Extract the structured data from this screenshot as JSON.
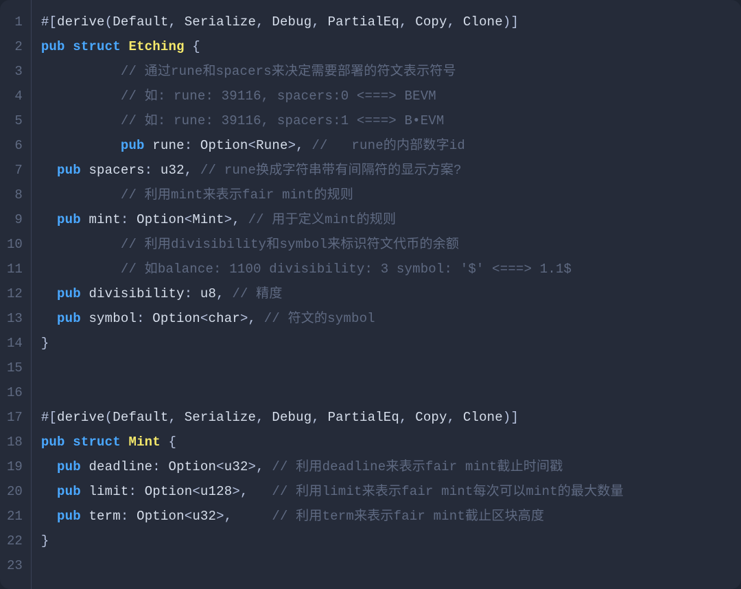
{
  "language": "rust",
  "theme": {
    "background": "#252b39",
    "gutter_border": "#3a4256",
    "line_number": "#5f6a82",
    "default_text": "#d6deeb",
    "keyword": "#4aa8ff",
    "struct_name": "#f5e96b",
    "comment": "#5f6a82"
  },
  "lines": [
    {
      "n": 1,
      "tokens": [
        {
          "c": "tok-punct",
          "t": "#["
        },
        {
          "c": "tok-attr",
          "t": "derive"
        },
        {
          "c": "tok-punct",
          "t": "("
        },
        {
          "c": "tok-attr",
          "t": "Default"
        },
        {
          "c": "tok-punct",
          "t": ", "
        },
        {
          "c": "tok-attr",
          "t": "Serialize"
        },
        {
          "c": "tok-punct",
          "t": ", "
        },
        {
          "c": "tok-attr",
          "t": "Debug"
        },
        {
          "c": "tok-punct",
          "t": ", "
        },
        {
          "c": "tok-attr",
          "t": "PartialEq"
        },
        {
          "c": "tok-punct",
          "t": ", "
        },
        {
          "c": "tok-attr",
          "t": "Copy"
        },
        {
          "c": "tok-punct",
          "t": ", "
        },
        {
          "c": "tok-attr",
          "t": "Clone"
        },
        {
          "c": "tok-punct",
          "t": ")]"
        }
      ]
    },
    {
      "n": 2,
      "tokens": [
        {
          "c": "tok-kw",
          "t": "pub"
        },
        {
          "c": "tok-punct",
          "t": " "
        },
        {
          "c": "tok-kw",
          "t": "struct"
        },
        {
          "c": "tok-punct",
          "t": " "
        },
        {
          "c": "tok-struct",
          "t": "Etching"
        },
        {
          "c": "tok-punct",
          "t": " {"
        }
      ]
    },
    {
      "n": 3,
      "tokens": [
        {
          "c": "tok-punct",
          "t": "          "
        },
        {
          "c": "tok-comment",
          "t": "// 通过rune和spacers来决定需要部署的符文表示符号"
        }
      ]
    },
    {
      "n": 4,
      "tokens": [
        {
          "c": "tok-punct",
          "t": "          "
        },
        {
          "c": "tok-comment",
          "t": "// 如: rune: 39116, spacers:0 <===> BEVM"
        }
      ]
    },
    {
      "n": 5,
      "tokens": [
        {
          "c": "tok-punct",
          "t": "          "
        },
        {
          "c": "tok-comment",
          "t": "// 如: rune: 39116, spacers:1 <===> B•EVM"
        }
      ]
    },
    {
      "n": 6,
      "tokens": [
        {
          "c": "tok-punct",
          "t": "          "
        },
        {
          "c": "tok-kw",
          "t": "pub"
        },
        {
          "c": "tok-punct",
          "t": " "
        },
        {
          "c": "tok-ident",
          "t": "rune"
        },
        {
          "c": "tok-punct",
          "t": ": "
        },
        {
          "c": "tok-type",
          "t": "Option"
        },
        {
          "c": "tok-punct",
          "t": "<"
        },
        {
          "c": "tok-type",
          "t": "Rune"
        },
        {
          "c": "tok-punct",
          "t": ">, "
        },
        {
          "c": "tok-comment",
          "t": "//   rune的内部数字id"
        }
      ]
    },
    {
      "n": 7,
      "tokens": [
        {
          "c": "tok-punct",
          "t": "  "
        },
        {
          "c": "tok-kw",
          "t": "pub"
        },
        {
          "c": "tok-punct",
          "t": " "
        },
        {
          "c": "tok-ident",
          "t": "spacers"
        },
        {
          "c": "tok-punct",
          "t": ": "
        },
        {
          "c": "tok-type",
          "t": "u32"
        },
        {
          "c": "tok-punct",
          "t": ", "
        },
        {
          "c": "tok-comment",
          "t": "// rune换成字符串带有间隔符的显示方案?"
        }
      ]
    },
    {
      "n": 8,
      "tokens": [
        {
          "c": "tok-punct",
          "t": "          "
        },
        {
          "c": "tok-comment",
          "t": "// 利用mint来表示fair mint的规则"
        }
      ]
    },
    {
      "n": 9,
      "tokens": [
        {
          "c": "tok-punct",
          "t": "  "
        },
        {
          "c": "tok-kw",
          "t": "pub"
        },
        {
          "c": "tok-punct",
          "t": " "
        },
        {
          "c": "tok-ident",
          "t": "mint"
        },
        {
          "c": "tok-punct",
          "t": ": "
        },
        {
          "c": "tok-type",
          "t": "Option"
        },
        {
          "c": "tok-punct",
          "t": "<"
        },
        {
          "c": "tok-type",
          "t": "Mint"
        },
        {
          "c": "tok-punct",
          "t": ">, "
        },
        {
          "c": "tok-comment",
          "t": "// 用于定义mint的规则"
        }
      ]
    },
    {
      "n": 10,
      "tokens": [
        {
          "c": "tok-punct",
          "t": "          "
        },
        {
          "c": "tok-comment",
          "t": "// 利用divisibility和symbol来标识符文代币的余额"
        }
      ]
    },
    {
      "n": 11,
      "tokens": [
        {
          "c": "tok-punct",
          "t": "          "
        },
        {
          "c": "tok-comment",
          "t": "// 如balance: 1100 divisibility: 3 symbol: '$' <===> 1.1$"
        }
      ]
    },
    {
      "n": 12,
      "tokens": [
        {
          "c": "tok-punct",
          "t": "  "
        },
        {
          "c": "tok-kw",
          "t": "pub"
        },
        {
          "c": "tok-punct",
          "t": " "
        },
        {
          "c": "tok-ident",
          "t": "divisibility"
        },
        {
          "c": "tok-punct",
          "t": ": "
        },
        {
          "c": "tok-type",
          "t": "u8"
        },
        {
          "c": "tok-punct",
          "t": ", "
        },
        {
          "c": "tok-comment",
          "t": "// 精度"
        }
      ]
    },
    {
      "n": 13,
      "tokens": [
        {
          "c": "tok-punct",
          "t": "  "
        },
        {
          "c": "tok-kw",
          "t": "pub"
        },
        {
          "c": "tok-punct",
          "t": " "
        },
        {
          "c": "tok-ident",
          "t": "symbol"
        },
        {
          "c": "tok-punct",
          "t": ": "
        },
        {
          "c": "tok-type",
          "t": "Option"
        },
        {
          "c": "tok-punct",
          "t": "<"
        },
        {
          "c": "tok-type",
          "t": "char"
        },
        {
          "c": "tok-punct",
          "t": ">, "
        },
        {
          "c": "tok-comment",
          "t": "// 符文的symbol"
        }
      ]
    },
    {
      "n": 14,
      "tokens": [
        {
          "c": "tok-punct",
          "t": "}"
        }
      ]
    },
    {
      "n": 15,
      "tokens": []
    },
    {
      "n": 16,
      "tokens": []
    },
    {
      "n": 17,
      "tokens": [
        {
          "c": "tok-punct",
          "t": "#["
        },
        {
          "c": "tok-attr",
          "t": "derive"
        },
        {
          "c": "tok-punct",
          "t": "("
        },
        {
          "c": "tok-attr",
          "t": "Default"
        },
        {
          "c": "tok-punct",
          "t": ", "
        },
        {
          "c": "tok-attr",
          "t": "Serialize"
        },
        {
          "c": "tok-punct",
          "t": ", "
        },
        {
          "c": "tok-attr",
          "t": "Debug"
        },
        {
          "c": "tok-punct",
          "t": ", "
        },
        {
          "c": "tok-attr",
          "t": "PartialEq"
        },
        {
          "c": "tok-punct",
          "t": ", "
        },
        {
          "c": "tok-attr",
          "t": "Copy"
        },
        {
          "c": "tok-punct",
          "t": ", "
        },
        {
          "c": "tok-attr",
          "t": "Clone"
        },
        {
          "c": "tok-punct",
          "t": ")]"
        }
      ]
    },
    {
      "n": 18,
      "tokens": [
        {
          "c": "tok-kw",
          "t": "pub"
        },
        {
          "c": "tok-punct",
          "t": " "
        },
        {
          "c": "tok-kw",
          "t": "struct"
        },
        {
          "c": "tok-punct",
          "t": " "
        },
        {
          "c": "tok-struct",
          "t": "Mint"
        },
        {
          "c": "tok-punct",
          "t": " {"
        }
      ]
    },
    {
      "n": 19,
      "tokens": [
        {
          "c": "tok-punct",
          "t": "  "
        },
        {
          "c": "tok-kw",
          "t": "pub"
        },
        {
          "c": "tok-punct",
          "t": " "
        },
        {
          "c": "tok-ident",
          "t": "deadline"
        },
        {
          "c": "tok-punct",
          "t": ": "
        },
        {
          "c": "tok-type",
          "t": "Option"
        },
        {
          "c": "tok-punct",
          "t": "<"
        },
        {
          "c": "tok-type",
          "t": "u32"
        },
        {
          "c": "tok-punct",
          "t": ">, "
        },
        {
          "c": "tok-comment",
          "t": "// 利用deadline来表示fair mint截止时间戳"
        }
      ]
    },
    {
      "n": 20,
      "tokens": [
        {
          "c": "tok-punct",
          "t": "  "
        },
        {
          "c": "tok-kw",
          "t": "pub"
        },
        {
          "c": "tok-punct",
          "t": " "
        },
        {
          "c": "tok-ident",
          "t": "limit"
        },
        {
          "c": "tok-punct",
          "t": ": "
        },
        {
          "c": "tok-type",
          "t": "Option"
        },
        {
          "c": "tok-punct",
          "t": "<"
        },
        {
          "c": "tok-type",
          "t": "u128"
        },
        {
          "c": "tok-punct",
          "t": ">,   "
        },
        {
          "c": "tok-comment",
          "t": "// 利用limit来表示fair mint每次可以mint的最大数量"
        }
      ]
    },
    {
      "n": 21,
      "tokens": [
        {
          "c": "tok-punct",
          "t": "  "
        },
        {
          "c": "tok-kw",
          "t": "pub"
        },
        {
          "c": "tok-punct",
          "t": " "
        },
        {
          "c": "tok-ident",
          "t": "term"
        },
        {
          "c": "tok-punct",
          "t": ": "
        },
        {
          "c": "tok-type",
          "t": "Option"
        },
        {
          "c": "tok-punct",
          "t": "<"
        },
        {
          "c": "tok-type",
          "t": "u32"
        },
        {
          "c": "tok-punct",
          "t": ">,     "
        },
        {
          "c": "tok-comment",
          "t": "// 利用term来表示fair mint截止区块高度"
        }
      ]
    },
    {
      "n": 22,
      "tokens": [
        {
          "c": "tok-punct",
          "t": "}"
        }
      ]
    },
    {
      "n": 23,
      "tokens": []
    }
  ]
}
